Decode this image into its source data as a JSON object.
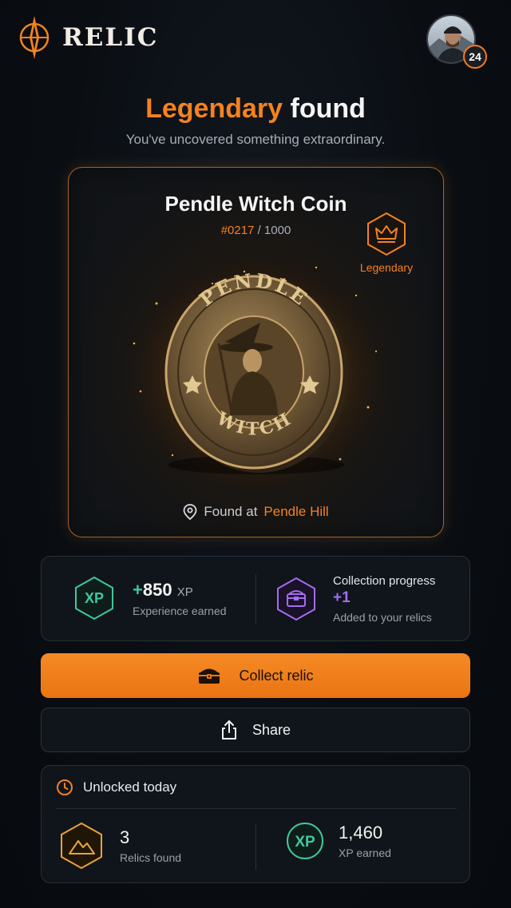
{
  "brand": {
    "name": "RELIC"
  },
  "profile": {
    "level": "24"
  },
  "hero": {
    "title_accent": "Legendary",
    "title_rest": "found",
    "subtitle": "You've uncovered something extraordinary."
  },
  "relic": {
    "name": "Pendle Witch Coin",
    "serial_number": "#0217",
    "serial_total": "/ 1000",
    "rarity": "Legendary",
    "coin_top_text": "PENDLE",
    "coin_bottom_text": "WITCH",
    "found_prefix": "Found at",
    "found_location": "Pendle Hill"
  },
  "rewards": {
    "xp_icon_label": "XP",
    "xp_plus": "+",
    "xp_value": "850",
    "xp_unit": "XP",
    "xp_caption": "Experience earned",
    "collection_title": "Collection progress",
    "collection_value": "+1",
    "collection_caption": "Added to your relics"
  },
  "actions": {
    "collect_label": "Collect relic",
    "share_label": "Share"
  },
  "today": {
    "title": "Unlocked today",
    "relics_count": "3",
    "relics_label": "Relics found",
    "xp_icon_label": "XP",
    "xp_total": "1,460",
    "xp_label": "XP earned"
  },
  "colors": {
    "accent": "#f5821f",
    "xp_green": "#3ec99a",
    "collection_purple": "#a56cf2",
    "background": "#0a0e13"
  },
  "icons": [
    "compass-logo-icon",
    "crown-icon",
    "location-pin-icon",
    "chest-icon",
    "share-icon",
    "clock-icon",
    "mountain-icon"
  ]
}
